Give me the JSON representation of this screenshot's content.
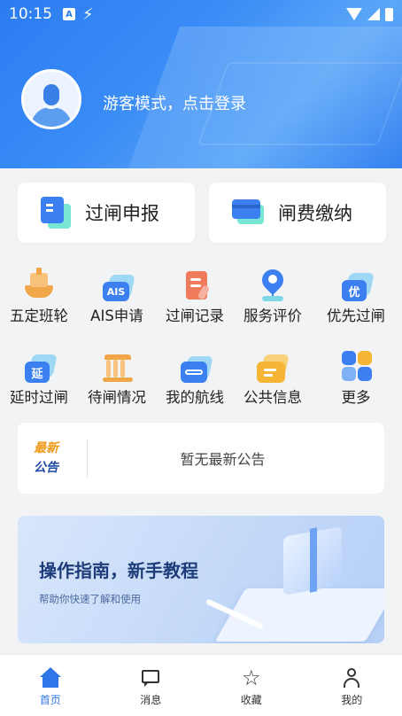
{
  "status_bar": {
    "time": "10:15",
    "icon_a": "A"
  },
  "header": {
    "login_text": "游客模式，点击登录"
  },
  "primary_actions": [
    {
      "label": "过闸申报",
      "icon": "document-icon"
    },
    {
      "label": "闸费缴纳",
      "icon": "card-icon"
    }
  ],
  "grid": [
    {
      "label": "五定班轮",
      "icon": "ship-icon",
      "badge": ""
    },
    {
      "label": "AIS申请",
      "icon": "ais-icon",
      "badge": "AIS"
    },
    {
      "label": "过闸记录",
      "icon": "clipboard-icon",
      "badge": ""
    },
    {
      "label": "服务评价",
      "icon": "heart-flower-icon",
      "badge": ""
    },
    {
      "label": "优先过闸",
      "icon": "priority-icon",
      "badge": "优"
    },
    {
      "label": "延时过闸",
      "icon": "delay-icon",
      "badge": "延"
    },
    {
      "label": "待闸情况",
      "icon": "gate-icon",
      "badge": ""
    },
    {
      "label": "我的航线",
      "icon": "route-icon",
      "badge": ""
    },
    {
      "label": "公共信息",
      "icon": "folder-icon",
      "badge": ""
    },
    {
      "label": "更多",
      "icon": "more-icon",
      "badge": ""
    }
  ],
  "notice": {
    "tag_line1": "最新",
    "tag_line2": "公告",
    "text": "暂无最新公告"
  },
  "banner": {
    "title": "操作指南，新手教程",
    "subtitle": "帮助你快速了解和使用"
  },
  "bottom_nav": [
    {
      "label": "首页",
      "icon": "home-icon",
      "active": true
    },
    {
      "label": "消息",
      "icon": "message-icon",
      "active": false
    },
    {
      "label": "收藏",
      "icon": "star-icon",
      "active": false
    },
    {
      "label": "我的",
      "icon": "user-icon",
      "active": false
    }
  ],
  "colors": {
    "primary": "#3b7ff0",
    "accent_teal": "#58e0c9",
    "orange": "#f09a1a"
  }
}
